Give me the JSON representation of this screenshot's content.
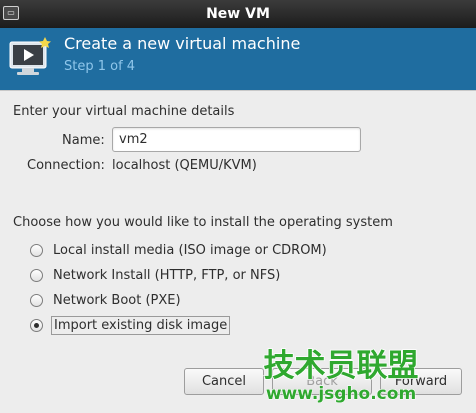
{
  "window": {
    "title": "New VM",
    "icon": "vm-app-icon"
  },
  "banner": {
    "title": "Create a new virtual machine",
    "step": "Step 1 of 4",
    "icon": "monitor-play-icon",
    "bg_color": "#1f6da0"
  },
  "details": {
    "heading": "Enter your virtual machine details",
    "name_label": "Name:",
    "name_value": "vm2",
    "connection_label": "Connection:",
    "connection_value": "localhost (QEMU/KVM)"
  },
  "install": {
    "heading": "Choose how you would like to install the operating system",
    "options": [
      {
        "label": "Local install media (ISO image or CDROM)",
        "selected": false
      },
      {
        "label": "Network Install (HTTP, FTP, or NFS)",
        "selected": false
      },
      {
        "label": "Network Boot (PXE)",
        "selected": false
      },
      {
        "label": "Import existing disk image",
        "selected": true
      }
    ]
  },
  "buttons": {
    "cancel": "Cancel",
    "back": "Back",
    "forward": "Forward"
  },
  "watermark": {
    "line1": "技术员联盟",
    "line2": "www.jsgho.com"
  }
}
